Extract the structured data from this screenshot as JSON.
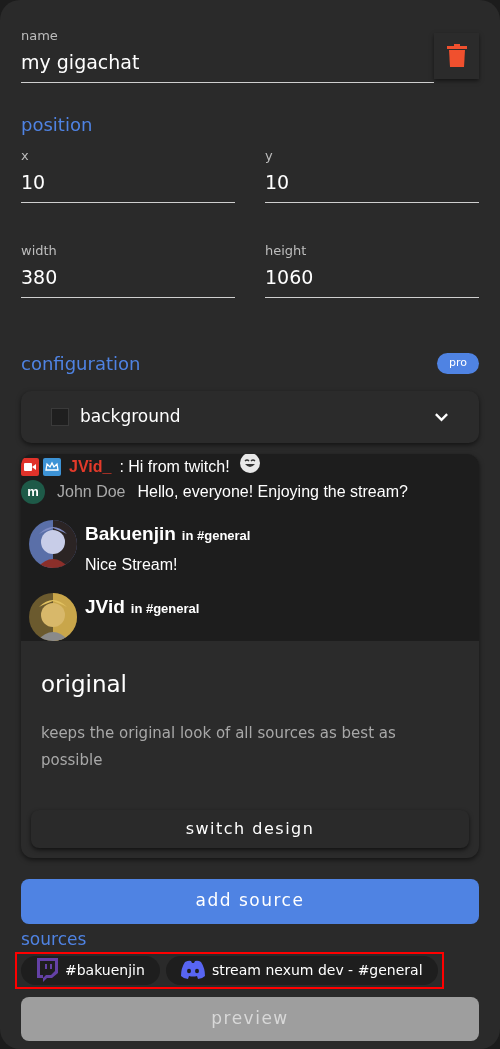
{
  "name_field": {
    "label": "name",
    "value": "my gigachat"
  },
  "position": {
    "title": "position",
    "fields": [
      {
        "label": "x",
        "value": "10"
      },
      {
        "label": "y",
        "value": "10"
      },
      {
        "label": "width",
        "value": "380"
      },
      {
        "label": "height",
        "value": "1060"
      }
    ]
  },
  "configuration": {
    "title": "configuration",
    "badge": "pro",
    "background": {
      "label": "background",
      "checked": false,
      "expanded": false
    }
  },
  "chat_preview": {
    "messages": [
      {
        "kind": "twitch",
        "user": "JVid_",
        "text": ": Hi from twitch!"
      },
      {
        "kind": "initial",
        "initial": "m",
        "user": "John Doe",
        "text": "Hello, everyone! Enjoying the stream?"
      },
      {
        "kind": "discord",
        "user": "Bakuenjin",
        "channel": "in #general",
        "text": "Nice Stream!"
      },
      {
        "kind": "discord",
        "user": "JVid",
        "channel": "in #general"
      }
    ]
  },
  "design": {
    "title": "original",
    "description": "keeps the original look of all sources as best as possible",
    "button": "switch design"
  },
  "add_button": "add source",
  "sources": {
    "title": "sources",
    "items": [
      {
        "kind": "twitch",
        "label": "#bakuenjin"
      },
      {
        "kind": "discord",
        "label": "stream nexum dev - #general"
      }
    ]
  },
  "preview_button": {
    "label": "preview",
    "disabled": true
  }
}
